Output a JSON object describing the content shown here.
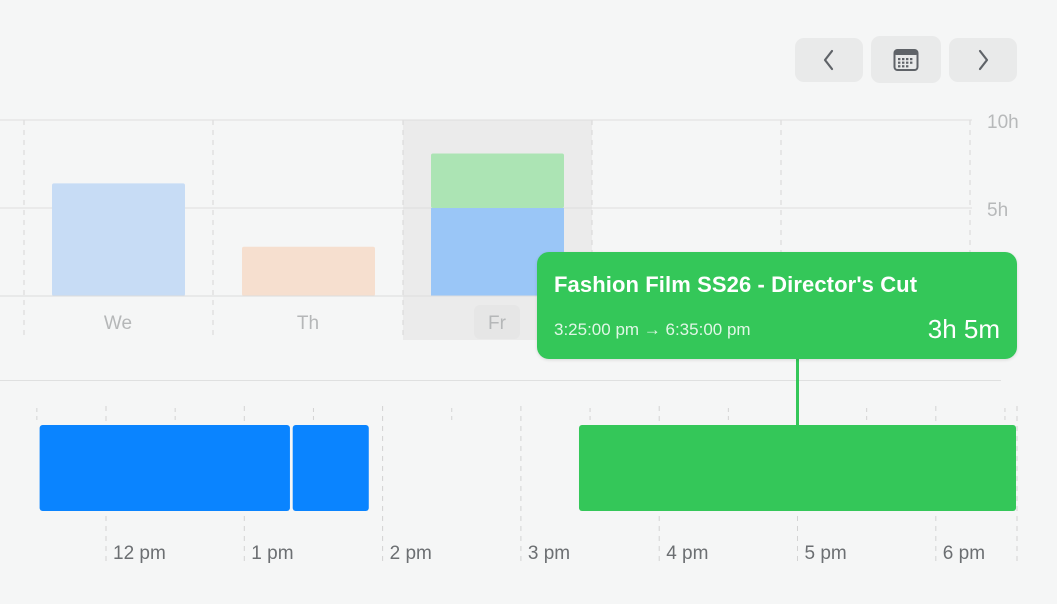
{
  "nav": {
    "prev_icon": "chevron-left-icon",
    "calendar_icon": "calendar-icon",
    "next_icon": "chevron-right-icon",
    "icon_color": "#5f6368"
  },
  "week_chart": {
    "type": "bar",
    "y_ticks": [
      "10h",
      "5h"
    ],
    "ylim": [
      0,
      10
    ],
    "days": [
      {
        "label": "We",
        "segments": [
          {
            "hours": 6.4,
            "color": "#c7dcf5"
          }
        ]
      },
      {
        "label": "Th",
        "segments": [
          {
            "hours": 2.8,
            "color": "#f6dfcf"
          }
        ]
      },
      {
        "label": "Fr",
        "selected": true,
        "segments": [
          {
            "hours": 5.0,
            "color": "#9ac6f7"
          },
          {
            "hours": 3.1,
            "color": "#ace4b4"
          }
        ]
      }
    ],
    "grid": true
  },
  "timeline": {
    "hour_labels": [
      "12 pm",
      "1 pm",
      "2 pm",
      "3 pm",
      "4 pm",
      "5 pm",
      "6 pm"
    ],
    "entries": [
      {
        "name": "entry-blue-1",
        "start": 11.52,
        "end": 13.33,
        "color": "#0a84ff"
      },
      {
        "name": "entry-blue-2",
        "start": 13.35,
        "end": 13.9,
        "color": "#0a84ff"
      },
      {
        "name": "entry-green",
        "start": 15.42,
        "end": 18.58,
        "color": "#34c759"
      }
    ]
  },
  "tooltip": {
    "title": "Fashion Film SS26 - Director's Cut",
    "range": "3:25:00 pm → 6:35:00 pm",
    "duration": "3h 5m",
    "color": "#34c759"
  }
}
